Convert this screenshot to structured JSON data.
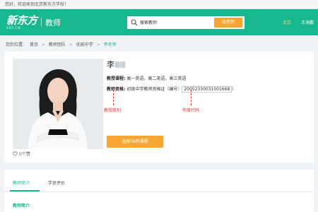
{
  "topbar": {
    "welcome": "您好，欢迎来到北京新东方学校！"
  },
  "header": {
    "logo_main": "新东方",
    "logo_sub": "XDF.CN",
    "section_title": "教师",
    "search_placeholder": "搜索教师",
    "search_button": "找老师",
    "region": "北京",
    "user": "王海鹏"
  },
  "breadcrumb": {
    "prefix": "您的位置:",
    "items": [
      "首页",
      "教师团队",
      "优能中学",
      "李老师"
    ]
  },
  "profile": {
    "name": "李",
    "courses_label": "教授课程:",
    "courses_value": "高一英语，高二英语，高三英语",
    "cert_label": "教师资格:",
    "cert_value": "初级中学教师资格证（编号：",
    "cert_number": "20052330031001668",
    "cert_close": "）",
    "annotation_level": "教授级别",
    "annotation_year": "年度代码",
    "book_button": "选择TA的课程",
    "likes": "0个赞"
  },
  "tabs": [
    {
      "label": "教师简介",
      "active": true
    },
    {
      "label": "学员评价",
      "active": false
    }
  ],
  "section": {
    "title": "教师简介"
  },
  "colors": {
    "brand": "#17b88f",
    "accent": "#f7a634",
    "annotation": "#e23b3b"
  }
}
